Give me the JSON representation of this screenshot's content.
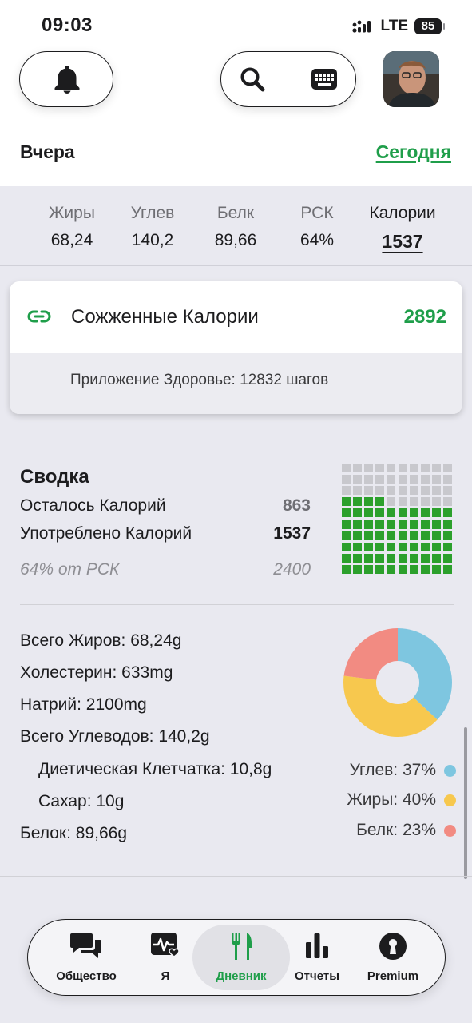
{
  "status_bar": {
    "time": "09:03",
    "network": "LTE",
    "battery": "85"
  },
  "header": {
    "yesterday_label": "Вчера",
    "today_label": "Сегодня"
  },
  "macros": [
    {
      "label": "Жиры",
      "value": "68,24"
    },
    {
      "label": "Углев",
      "value": "140,2"
    },
    {
      "label": "Белк",
      "value": "89,66"
    },
    {
      "label": "РСК",
      "value": "64%"
    },
    {
      "label": "Калории",
      "value": "1537"
    }
  ],
  "burned": {
    "label": "Сожженные Калории",
    "value": "2892",
    "health_text": "Приложение Здоровье: 12832 шагов"
  },
  "summary": {
    "title": "Сводка",
    "remaining_label": "Осталось Калорий",
    "remaining_value": "863",
    "consumed_label": "Употреблено Калорий",
    "consumed_value": "1537",
    "rsk_label": "64% от РСК",
    "rsk_value": "2400",
    "waffle_filled_fraction": 0.64,
    "colors": {
      "filled": "#2ca02c",
      "empty": "#c8c8cd"
    }
  },
  "nutrients": {
    "total_fat": "Всего Жиров: 68,24g",
    "cholesterol": "Холестерин: 633mg",
    "sodium": "Натрий: 2100mg",
    "total_carbs": "Всего Углеводов: 140,2g",
    "fiber": "Диетическая Клетчатка: 10,8g",
    "sugar": "Сахар: 10g",
    "protein": "Белок: 89,66g"
  },
  "macro_split": {
    "items": [
      {
        "label": "Углев: 37%",
        "percent": 37,
        "color": "#7ec6e0"
      },
      {
        "label": "Жиры: 40%",
        "percent": 40,
        "color": "#f7c84e"
      },
      {
        "label": "Белк: 23%",
        "percent": 23,
        "color": "#f28b82"
      }
    ]
  },
  "tabs": [
    {
      "label": "Общество",
      "icon": "chat-bubbles-icon"
    },
    {
      "label": "Я",
      "icon": "heart-pulse-icon"
    },
    {
      "label": "Дневник",
      "icon": "fork-knife-icon",
      "active": true
    },
    {
      "label": "Отчеты",
      "icon": "bar-chart-icon"
    },
    {
      "label": "Premium",
      "icon": "keyhole-icon"
    }
  ],
  "colors": {
    "accent_green": "#1f9e4a",
    "background": "#e9e9f0"
  }
}
